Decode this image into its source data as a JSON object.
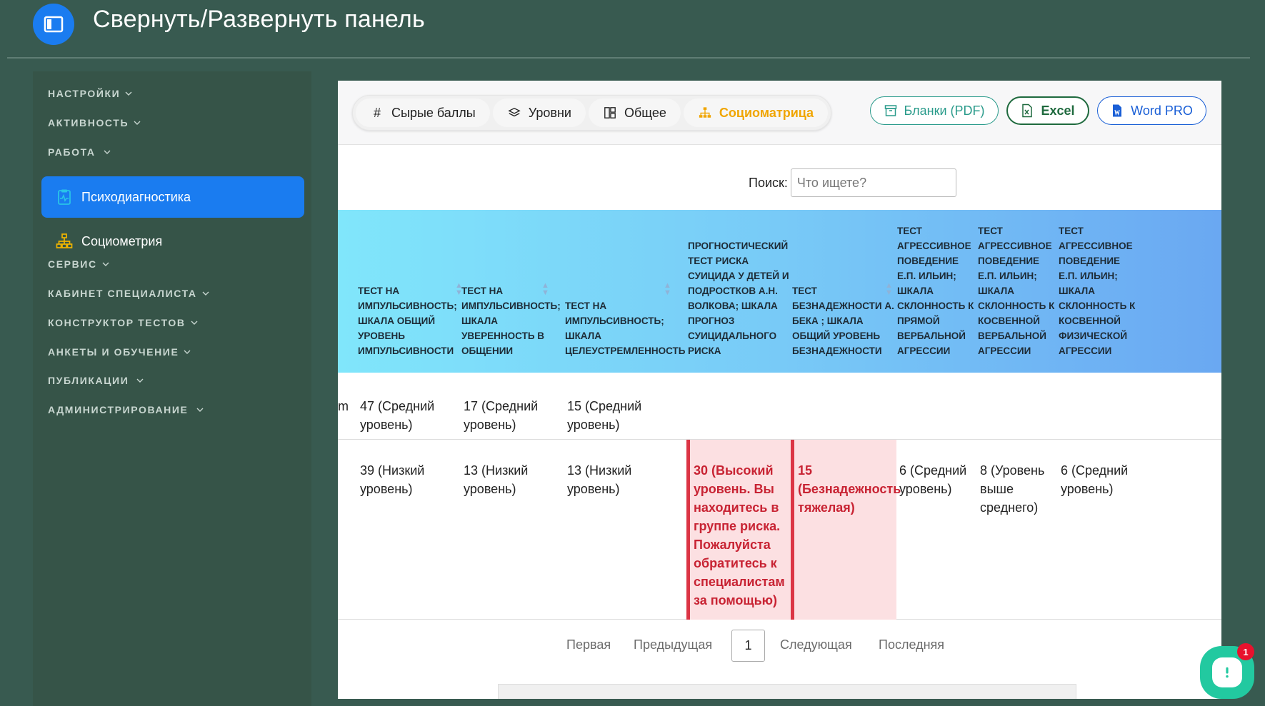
{
  "header": {
    "title": "Свернуть/Развернуть панель"
  },
  "sidebar": {
    "sections": [
      {
        "label": "НАСТРОЙКИ"
      },
      {
        "label": "АКТИВНОСТЬ"
      },
      {
        "label": "РАБОТА"
      },
      {
        "label": "СЕРВИС"
      },
      {
        "label": "КАБИНЕТ СПЕЦИАЛИСТА"
      },
      {
        "label": "КОНСТРУКТОР ТЕСТОВ"
      },
      {
        "label": "АНКЕТЫ И ОБУЧЕНИЕ"
      },
      {
        "label": "ПУБЛИКАЦИИ"
      },
      {
        "label": "АДМИНИСТРИРОВАНИЕ"
      }
    ],
    "items": [
      {
        "label": "Психодиагностика",
        "active": true
      },
      {
        "label": "Социометрия",
        "active": false
      }
    ]
  },
  "toolbar": {
    "tabs": [
      {
        "icon": "#",
        "label": "Сырые баллы"
      },
      {
        "label": "Уровни"
      },
      {
        "label": "Общее"
      },
      {
        "label": "Социоматрица",
        "active": true
      }
    ],
    "export": {
      "pdf": "Бланки (PDF)",
      "excel": "Excel",
      "word": "Word PRO"
    }
  },
  "search": {
    "label": "Поиск:",
    "placeholder": "Что ищете?",
    "value": ""
  },
  "table": {
    "headers": [
      "ТЕСТ НА ИМПУЛЬСИВНОСТЬ; ШКАЛА ОБЩИЙ УРОВЕНЬ ИМПУЛЬСИВНОСТИ",
      "ТЕСТ НА ИМПУЛЬСИВНОСТЬ; ШКАЛА УВЕРЕННОСТЬ В ОБЩЕНИИ",
      "ТЕСТ НА ИМПУЛЬСИВНОСТЬ; ШКАЛА ЦЕЛЕУСТРЕМЛЕННОСТЬ",
      "ПРОГНОСТИЧЕСКИЙ ТЕСТ РИСКА СУИЦИДА У ДЕТЕЙ И ПОДРОСТКОВ А.Н. ВОЛКОВА; ШКАЛА ПРОГНОЗ СУИЦИДАЛЬНОГО РИСКА",
      "ТЕСТ БЕЗНАДЕЖНОСТИ А. БЕКА ; ШКАЛА ОБЩИЙ УРОВЕНЬ БЕЗНАДЕЖНОСТИ",
      "ТЕСТ АГРЕССИВНОЕ ПОВЕДЕНИЕ Е.П. ИЛЬИН; ШКАЛА СКЛОННОСТЬ К ПРЯМОЙ ВЕРБАЛЬНОЙ АГРЕССИИ",
      "ТЕСТ АГРЕССИВНОЕ ПОВЕДЕНИЕ Е.П. ИЛЬИН; ШКАЛА СКЛОННОСТЬ К КОСВЕННОЙ ВЕРБАЛЬНОЙ АГРЕССИИ",
      "ТЕСТ АГРЕССИВНОЕ ПОВЕДЕНИЕ Е.П. ИЛЬИН; ШКАЛА СКЛОННОСТЬ К КОСВЕННОЙ ФИЗИЧЕСКОЙ АГРЕССИИ"
    ],
    "rows": [
      {
        "prefix": "m",
        "cells": [
          "47 (Средний уровень)",
          "17 (Средний уровень)",
          "15 (Средний уровень)",
          "",
          "",
          "",
          "",
          ""
        ]
      },
      {
        "prefix": "",
        "cells": [
          "39 (Низкий уровень)",
          "13 (Низкий уровень)",
          "13 (Низкий уровень)",
          "30 (Высокий уровень. Вы находитесь в группе риска. Пожалуйста обратитесь к специалистам за помощью)",
          "15 (Безнадежность тяжелая)",
          "6 (Средний уровень)",
          "8 (Уровень выше среднего)",
          "6 (Средний уровень)"
        ]
      }
    ]
  },
  "pagination": {
    "first": "Первая",
    "prev": "Предыдущая",
    "current": "1",
    "next": "Следующая",
    "last": "Последняя"
  },
  "chat": {
    "badge": "1"
  },
  "colors": {
    "accent": "#1a7cf0",
    "background": "#385a50",
    "danger": "#dc3545",
    "warning": "#f0a500",
    "chat": "#22c9a0"
  }
}
